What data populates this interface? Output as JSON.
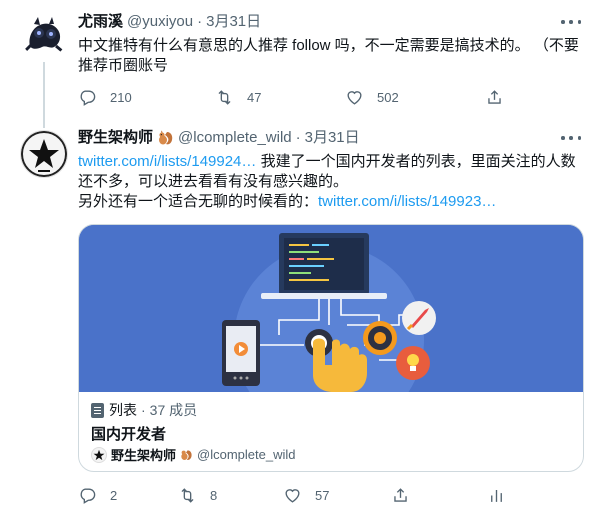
{
  "tweets": [
    {
      "name": "尤雨溪",
      "handle": "@yuxiyou",
      "separator": "·",
      "date": "3月31日",
      "text": "中文推特有什么有意思的人推荐 follow 吗，不一定需要是搞技术的。 （不要推荐币圈账号",
      "actions": {
        "reply": "210",
        "retweet": "47",
        "like": "502"
      }
    },
    {
      "name": "野生架构师",
      "handle": "@lcomplete_wild",
      "separator": "·",
      "date": "3月31日",
      "link1": "twitter.com/i/lists/149924…",
      "text1": " 我建了一个国内开发者的列表，里面关注的人数还不多，可以进去看看有没有感兴趣的。",
      "text2": "另外还有一个适合无聊的时候看的：",
      "link2": "twitter.com/i/lists/149923…",
      "card": {
        "kind": "列表",
        "separator": "·",
        "members": "37 成员",
        "title": "国内开发者",
        "owner_name": "野生架构师",
        "owner_handle": "@lcomplete_wild"
      },
      "actions": {
        "reply": "2",
        "retweet": "8",
        "like": "57"
      }
    }
  ],
  "colors": {
    "link": "#1d9bf0",
    "muted": "#536471",
    "card_bg": "#4a72c9"
  },
  "icons": [
    "reply-icon",
    "retweet-icon",
    "like-icon",
    "share-icon",
    "analytics-icon",
    "more-icon",
    "squirrel-emoji",
    "list-icon"
  ]
}
